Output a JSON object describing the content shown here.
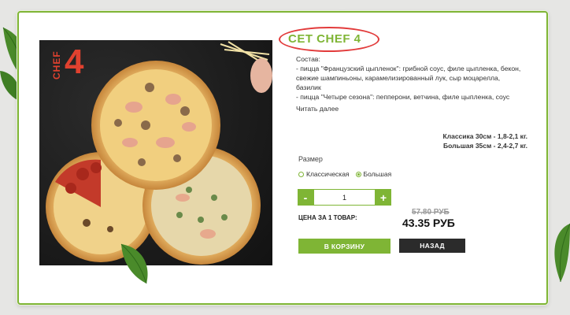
{
  "product": {
    "title": "СЕТ CHEF 4",
    "photo_label": "CHEF",
    "photo_number": "4",
    "description_lines": [
      "Состав:",
      "- пицца \"Французский цыпленок\": грибной соус, филе цыпленка, бекон,",
      "свежие шампиньоны, карамелизированный лук, сыр моцарелла,",
      "базилик",
      "- пицца \"Четыре сезона\": пепперони, ветчина, филе цыпленка, соус"
    ],
    "read_more": "Читать далее",
    "sizes_info": [
      "Классика 30см - 1,8-2,1 кг.",
      "Большая 35см - 2,4-2,7 кг."
    ]
  },
  "options": {
    "size_title": "Размер",
    "sizes": [
      {
        "label": "Классическая",
        "selected": false
      },
      {
        "label": "Большая",
        "selected": true
      }
    ]
  },
  "quantity": {
    "minus": "-",
    "value": "1",
    "plus": "+"
  },
  "price": {
    "label": "ЦЕНА ЗА 1 ТОВАР:",
    "old": "57.80 РУБ",
    "new": "43.35 РУБ"
  },
  "actions": {
    "cart": "В КОРЗИНУ",
    "back": "НАЗАД"
  },
  "colors": {
    "accent": "#7fb535",
    "highlight": "#e23b3b",
    "dark_button": "#2b2b2b"
  }
}
